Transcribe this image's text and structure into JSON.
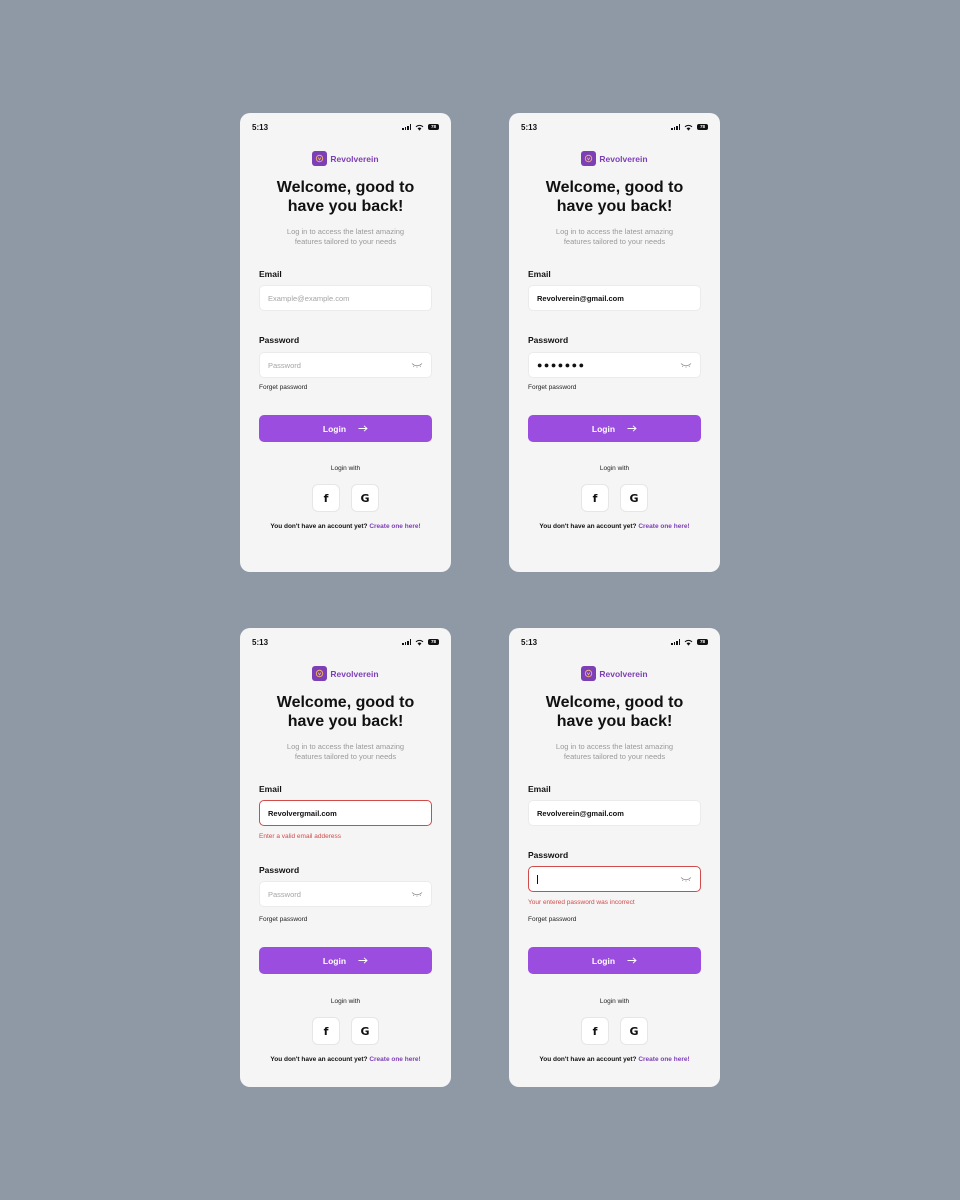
{
  "status_time": "5:13",
  "battery": "78",
  "brand": "Revolverein",
  "title_line1": "Welcome, good to",
  "title_line2": "have you back!",
  "subtitle_line1": "Log in to access the latest amazing",
  "subtitle_line2": "features tailored to your needs",
  "email_label": "Email",
  "email_placeholder": "Example@example.com",
  "password_label": "Password",
  "password_placeholder": "Password",
  "forget_password": "Forget password",
  "login_button": "Login",
  "login_with": "Login with",
  "facebook_glyph": "f",
  "google_glyph": "G",
  "no_account": "You don't have an account yet?",
  "create_link": "Create one here!",
  "colors": {
    "background": "#8f99a6",
    "card": "#f5f5f5",
    "accent": "#9b4de0",
    "brand": "#7d3fb5",
    "error": "#d14b4b"
  },
  "screens": [
    {
      "state": "empty",
      "email_value": "",
      "password_value": ""
    },
    {
      "state": "filled",
      "email_value": "Revolverein@gmail.com",
      "password_value": "●●●●●●●"
    },
    {
      "state": "email-error",
      "email_value": "Revolvergmail.com",
      "email_error": "Enter a valid email adderess",
      "password_value": ""
    },
    {
      "state": "password-error",
      "email_value": "Revolverein@gmail.com",
      "password_value": "",
      "password_error": "Your entered password was incorrect"
    }
  ]
}
